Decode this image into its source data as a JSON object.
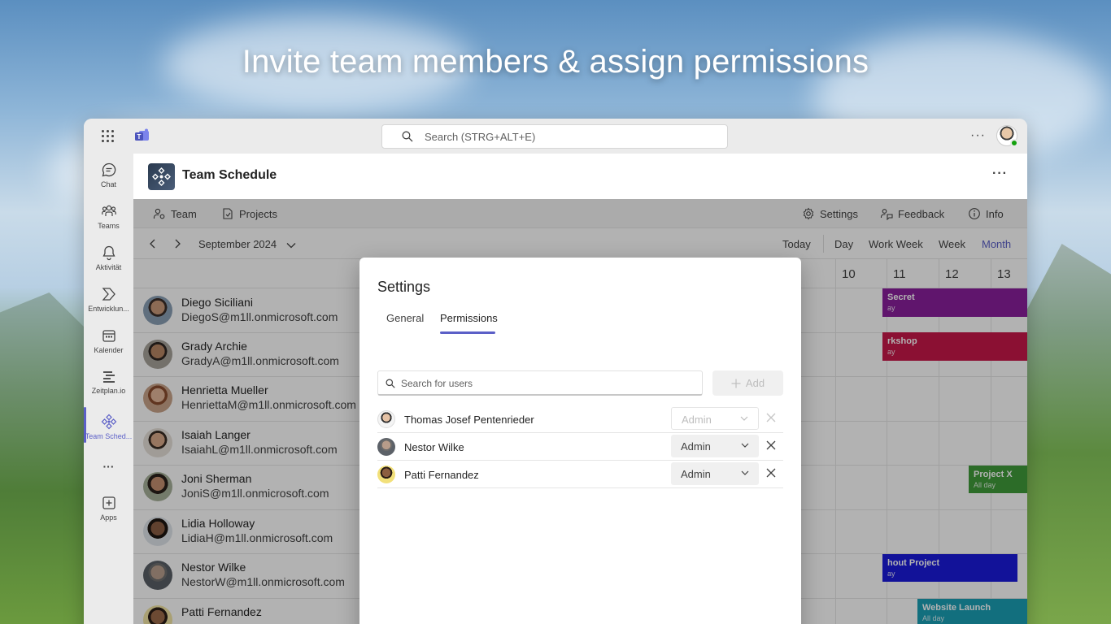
{
  "headline": "Invite team members & assign permissions",
  "titlebar": {
    "search_placeholder": "Search (STRG+ALT+E)",
    "more": "···"
  },
  "rail": {
    "items": [
      {
        "label": "Chat",
        "icon": "chat-icon"
      },
      {
        "label": "Teams",
        "icon": "teams-icon"
      },
      {
        "label": "Aktivität",
        "icon": "bell-icon"
      },
      {
        "label": "Entwicklun...",
        "icon": "developer-icon"
      },
      {
        "label": "Kalender",
        "icon": "calendar-icon"
      },
      {
        "label": "Zeitplan.io",
        "icon": "timeline-icon"
      },
      {
        "label": "Team Sched...",
        "icon": "team-schedule-icon"
      },
      {
        "label": "···",
        "icon": "more-icon"
      },
      {
        "label": "Apps",
        "icon": "apps-icon"
      }
    ]
  },
  "app": {
    "title": "Team Schedule",
    "more": "···"
  },
  "toolbar": {
    "team": "Team",
    "projects": "Projects",
    "settings": "Settings",
    "feedback": "Feedback",
    "info": "Info"
  },
  "nav": {
    "month_label": "September 2024",
    "today": "Today",
    "day": "Day",
    "work_week": "Work Week",
    "week": "Week",
    "month": "Month"
  },
  "days": [
    "10",
    "11",
    "12",
    "13"
  ],
  "people": [
    {
      "name": "Diego Siciliani",
      "email": "DiegoS@m1ll.onmicrosoft.com"
    },
    {
      "name": "Grady Archie",
      "email": "GradyA@m1ll.onmicrosoft.com"
    },
    {
      "name": "Henrietta Mueller",
      "email": "HenriettaM@m1ll.onmicrosoft.com"
    },
    {
      "name": "Isaiah Langer",
      "email": "IsaiahL@m1ll.onmicrosoft.com"
    },
    {
      "name": "Joni Sherman",
      "email": "JoniS@m1ll.onmicrosoft.com"
    },
    {
      "name": "Lidia Holloway",
      "email": "LidiaH@m1ll.onmicrosoft.com"
    },
    {
      "name": "Nestor Wilke",
      "email": "NestorW@m1ll.onmicrosoft.com"
    },
    {
      "name": "Patti Fernandez",
      "email": ""
    }
  ],
  "events": [
    {
      "title": "Secret",
      "sub": "ay",
      "color": "#8a1f9c"
    },
    {
      "title": "rkshop",
      "sub": "ay",
      "color": "#c8174a"
    },
    {
      "title": "Project X",
      "sub": "All day",
      "color": "#3f9b3a"
    },
    {
      "title": "hout Project",
      "sub": "ay",
      "color": "#1a1adb"
    },
    {
      "title": "Website Launch",
      "sub": "All day",
      "color": "#1a9fb5"
    }
  ],
  "dialog": {
    "title": "Settings",
    "tabs": [
      "General",
      "Permissions"
    ],
    "search_placeholder": "Search for users",
    "add": "Add",
    "users": [
      {
        "name": "Thomas Josef Pentenrieder",
        "role": "Admin",
        "disabled": true
      },
      {
        "name": "Nestor Wilke",
        "role": "Admin",
        "disabled": false
      },
      {
        "name": "Patti Fernandez",
        "role": "Admin",
        "disabled": false
      }
    ]
  },
  "colors": {
    "accent": "#5b5fc7"
  }
}
